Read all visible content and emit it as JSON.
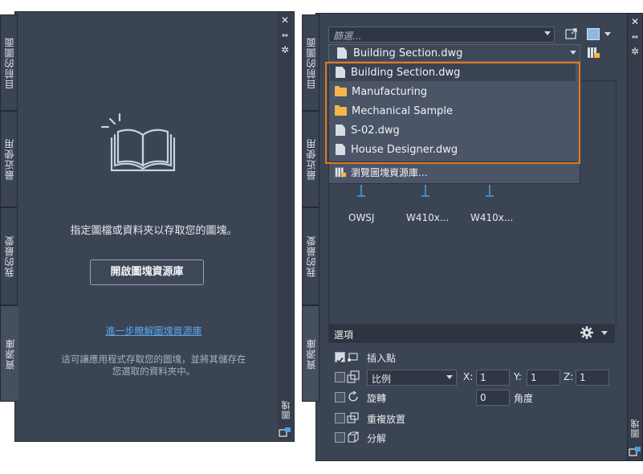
{
  "left_palette": {
    "tabs": [
      "目前的圖面",
      "最近使用",
      "我的最愛",
      "資源庫"
    ],
    "message": "指定圖檔或資料夾以存取您的圖塊。",
    "open_library_button": "開啟圖塊資源庫",
    "learn_more_link": "進一步瞭解圖塊資源庫",
    "description_line1": "這可讓應用程式存取您的圖塊，並將其儲存在",
    "description_line2": "您選取的資料夾中。",
    "palette_title": "圖塊",
    "close_glyph": "✕",
    "pin_glyph": "⇔",
    "settings_glyph": "✲"
  },
  "right_palette": {
    "tabs": [
      "目前的圖面",
      "最近使用",
      "我的最愛",
      "資源庫"
    ],
    "filter_placeholder": "篩選...",
    "current_library": "Building Section.dwg",
    "dropdown_items": [
      {
        "label": "Building Section.dwg",
        "icon": "file-icon"
      },
      {
        "label": "Manufacturing",
        "icon": "folder-icon"
      },
      {
        "label": "Mechanical Sample",
        "icon": "folder-icon"
      },
      {
        "label": "S-02.dwg",
        "icon": "file-icon"
      },
      {
        "label": "House Designer.dwg",
        "icon": "file-icon"
      }
    ],
    "browse_library": "瀏覽圖塊資源庫...",
    "blocks": [
      "OWSJ",
      "W410x...",
      "W410x..."
    ],
    "options": {
      "title": "選項",
      "insertion_point": "插入點",
      "scale": "比例",
      "x_label": "X:",
      "x_value": "1",
      "y_label": "Y:",
      "y_value": "1",
      "z_label": "Z:",
      "z_value": "1",
      "rotation": "旋轉",
      "rotation_value": "0",
      "angle": "角度",
      "repeat_placement": "重複放置",
      "explode": "分解",
      "insertion_point_checked": true
    },
    "palette_title": "圖塊",
    "highlight_color": "#e07b1d"
  }
}
